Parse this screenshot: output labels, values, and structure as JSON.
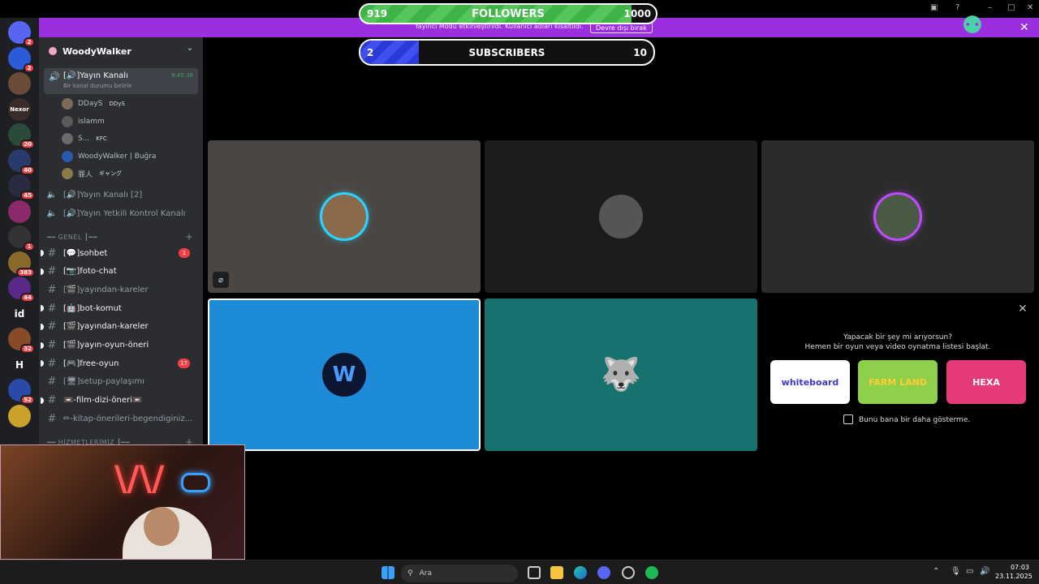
{
  "overlay": {
    "followers": {
      "current": "919",
      "label": "FOLLOWERS",
      "goal": "1000",
      "progress": 0.919
    },
    "subscribers": {
      "current": "2",
      "label": "SUBSCRIBERS",
      "goal": "10",
      "progress": 0.2
    }
  },
  "banner": {
    "text": "Yayıncı Modu etkinleştirildi. Kullanıcı adları kısaltıldı.",
    "button": "Devre dışı bırak",
    "bg": "#9b2fe0"
  },
  "rail": {
    "servers": [
      {
        "icon": "discord-icon",
        "badge": "2"
      },
      {
        "icon": "server-icon",
        "badge": "2"
      },
      {
        "icon": "server-icon",
        "badge": ""
      },
      {
        "icon": "server-icon",
        "label": "Nexor",
        "badge": ""
      },
      {
        "icon": "server-icon",
        "badge": "20"
      },
      {
        "icon": "server-icon",
        "badge": "40"
      },
      {
        "icon": "server-icon",
        "badge": "45"
      },
      {
        "icon": "server-icon",
        "badge": ""
      },
      {
        "icon": "server-icon",
        "badge": "1"
      },
      {
        "icon": "server-icon",
        "badge": "383"
      },
      {
        "icon": "server-icon",
        "badge": "44"
      },
      {
        "icon": "server-icon",
        "label": "id",
        "badge": ""
      },
      {
        "icon": "server-icon",
        "badge": "32"
      },
      {
        "icon": "server-icon",
        "label": "H",
        "badge": ""
      },
      {
        "icon": "server-icon",
        "badge": "52"
      },
      {
        "icon": "server-icon",
        "badge": ""
      }
    ]
  },
  "sidebar": {
    "server_name": "WoodyWalker",
    "active_voice": {
      "name": "[🔊]Yayın Kanalı",
      "status": "Bir kanal durumu belirle",
      "time": "9:45:38"
    },
    "voice_users": [
      {
        "name": "DDayS",
        "tag": "DDyS"
      },
      {
        "name": "islamm",
        "tag": ""
      },
      {
        "name": "S...",
        "tag": "KFC"
      },
      {
        "name": "WoodyWalker | Buğra",
        "tag": ""
      },
      {
        "name": "罪人",
        "tag": "ギャング"
      }
    ],
    "voice_channels": [
      "[🔊]Yayın Kanalı [2]",
      "[🔊]Yayın Yetkili Kontrol Kanalı"
    ],
    "category": "━━ GENEL ┃━━",
    "text_channels": [
      {
        "name": "[💬]sohbet",
        "unread": true,
        "badge": "1"
      },
      {
        "name": "[📷]foto-chat",
        "unread": true,
        "badge": ""
      },
      {
        "name": "[🎬]yayından-kareler",
        "unread": false,
        "badge": ""
      },
      {
        "name": "[🤖]bot-komut",
        "unread": true,
        "badge": ""
      },
      {
        "name": "[🎬]yayından-kareler",
        "unread": true,
        "badge": ""
      },
      {
        "name": "[🎬]yayın-oyun-öneri",
        "unread": true,
        "badge": ""
      },
      {
        "name": "[🎮]free-oyun",
        "unread": true,
        "badge": "17"
      },
      {
        "name": "[🖥]setup-paylaşımı",
        "unread": false,
        "badge": ""
      },
      {
        "name": "📼-film-dizi-öneri📼",
        "unread": true,
        "badge": ""
      },
      {
        "name": "✏-kitap-önerileri-begendiginiz...",
        "unread": false,
        "badge": ""
      }
    ],
    "category2": "━━ HİZMETLERİMİZ ┃━━"
  },
  "tiles": [
    {
      "bg": "#4a4643",
      "ring": "#2ad4ff"
    },
    {
      "bg": "#1c1c1c",
      "ring": ""
    },
    {
      "bg": "#2a2c2b",
      "ring": "#c04bff"
    },
    {
      "bg": "#1d8bd8",
      "ring": ""
    },
    {
      "bg": "#17716e",
      "ring": ""
    }
  ],
  "game_panel": {
    "title": "Yapacak bir şey mi arıyorsun?",
    "subtitle": "Hemen bir oyun veya video oynatma listesi başlat.",
    "games": [
      {
        "name": "whiteboard",
        "bg": "#ffffff",
        "color": "#3a3ad0"
      },
      {
        "name": "FARM LAND",
        "bg": "#8ed04a",
        "color": "#ffcc33"
      },
      {
        "name": "HEXA",
        "bg": "#e63b7a",
        "color": "#ffffff"
      }
    ],
    "checkbox_label": "Bunu bana bir daha gösterme."
  },
  "taskbar": {
    "search_placeholder": "Ara",
    "time": "07:03",
    "date": "23.11.2025"
  }
}
